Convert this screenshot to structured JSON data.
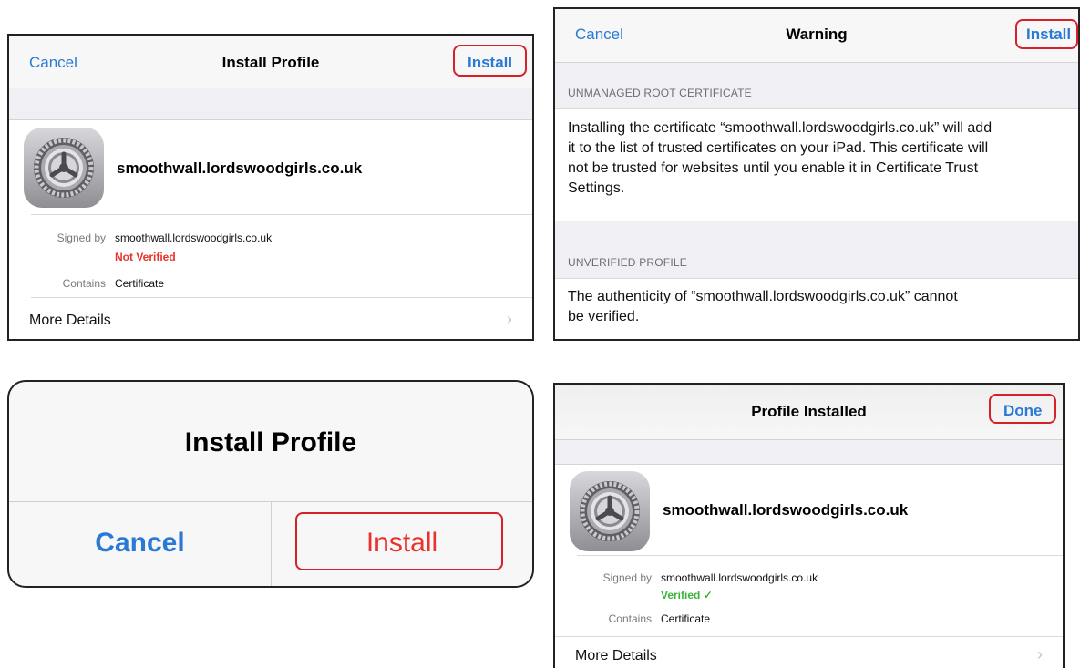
{
  "panel_install": {
    "cancel_label": "Cancel",
    "title": "Install Profile",
    "install_label": "Install",
    "profile_name": "smoothwall.lordswoodgirls.co.uk",
    "signed_by_label": "Signed by",
    "signed_by_value": "smoothwall.lordswoodgirls.co.uk",
    "verification": "Not Verified",
    "contains_label": "Contains",
    "contains_value": "Certificate",
    "more_details": "More Details",
    "chevron": "›"
  },
  "panel_warning": {
    "cancel_label": "Cancel",
    "title": "Warning",
    "install_label": "Install",
    "section1_header": "UNMANAGED ROOT CERTIFICATE",
    "section1_line1": "Installing the certificate “smoothwall.lordswoodgirls.co.uk” will add",
    "section1_line2": "it to the list of trusted certificates on your iPad. This certificate will",
    "section1_line3": "not be trusted for websites until you enable it in Certificate Trust",
    "section1_line4": "Settings.",
    "section2_header": "UNVERIFIED PROFILE",
    "section2_line1": "The authenticity of “smoothwall.lordswoodgirls.co.uk” cannot",
    "section2_line2": "be verified."
  },
  "panel_alert": {
    "title": "Install Profile",
    "cancel_label": "Cancel",
    "install_label": "Install"
  },
  "panel_installed": {
    "title": "Profile Installed",
    "done_label": "Done",
    "profile_name": "smoothwall.lordswoodgirls.co.uk",
    "signed_by_label": "Signed by",
    "signed_by_value": "smoothwall.lordswoodgirls.co.uk",
    "verification": "Verified ✓",
    "contains_label": "Contains",
    "contains_value": "Certificate",
    "more_details": "More Details",
    "chevron": "›"
  },
  "colors": {
    "accent_blue": "#2a7ad5",
    "destructive_red": "#e8322c",
    "verified_green": "#3cb43c",
    "highlight_red": "#d6202a"
  },
  "icons": {
    "profile_icon": "settings-gear-icon",
    "disclosure": "chevron-right-icon"
  }
}
